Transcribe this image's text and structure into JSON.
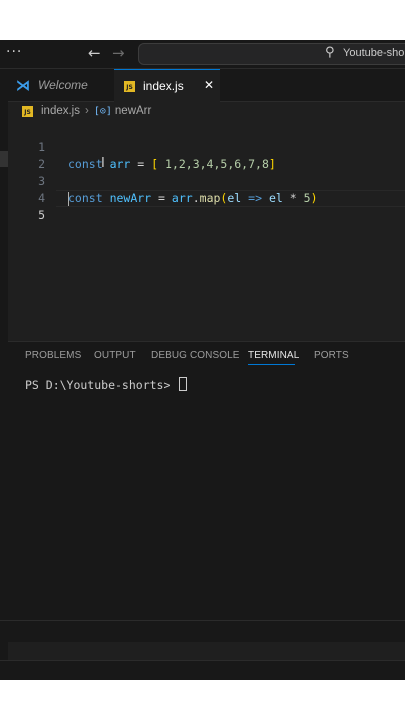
{
  "titlebar": {
    "menu": "···",
    "back_icon": "←",
    "forward_icon": "→",
    "search_text": "Youtube-shorts"
  },
  "tabs": [
    {
      "label": "Welcome",
      "icon": "vscode-icon"
    },
    {
      "label": "index.js",
      "icon": "js-file-icon",
      "active": true
    }
  ],
  "breadcrumb": {
    "file": "index.js",
    "symbol": "newArr"
  },
  "editor": {
    "line_numbers": [
      "1",
      "2",
      "3",
      "4",
      "5"
    ],
    "active_line": "5",
    "line1": {
      "kw": "const",
      "name": "arr",
      "eq": "=",
      "open": "[",
      "values": " 1,2,3,4,5,6,7,8",
      "close": "]"
    },
    "line3": {
      "kw": "const",
      "name": "newArr",
      "eq": "=",
      "obj": "arr",
      "dot": ".",
      "method": "map",
      "open": "(",
      "param": "el",
      "arrow": "=>",
      "body_var": "el",
      "mul": "*",
      "num": "5",
      "close": ")"
    }
  },
  "panel": {
    "tabs": [
      "PROBLEMS",
      "OUTPUT",
      "DEBUG CONSOLE",
      "TERMINAL",
      "PORTS"
    ],
    "active_tab": "TERMINAL",
    "prompt": "PS D:\\Youtube-shorts> "
  },
  "colors": {
    "accent": "#0078d4",
    "editor_bg": "#1f1f1f",
    "keyword": "#569cd6",
    "function": "#dcdcaa"
  }
}
